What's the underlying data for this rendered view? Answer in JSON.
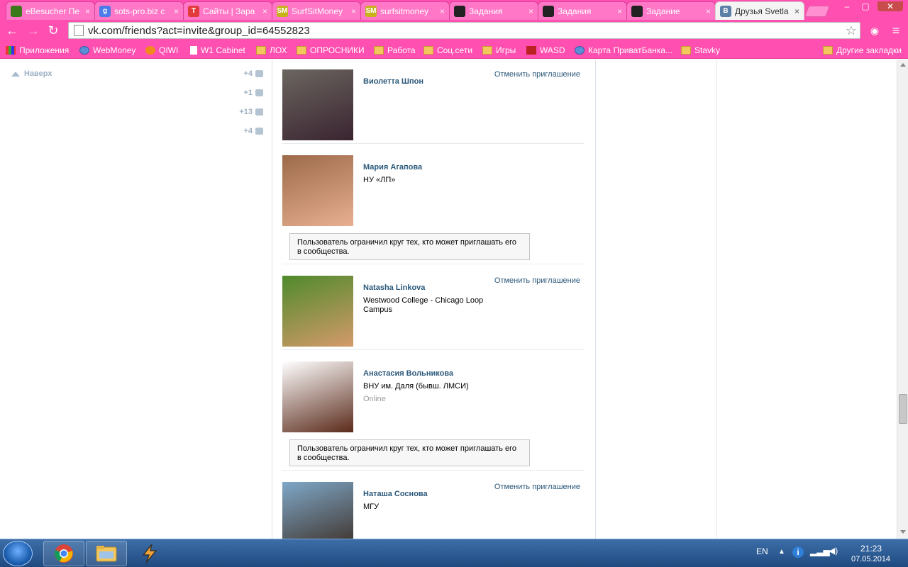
{
  "browser": {
    "tabs": [
      {
        "title": "eBesucher Пе",
        "color": "#3a7a1a",
        "glyph": ""
      },
      {
        "title": "sots-pro.biz с",
        "color": "#4b7be8",
        "glyph": "g"
      },
      {
        "title": "Сайты | Зара",
        "color": "#e23b3b",
        "glyph": "T"
      },
      {
        "title": "SurfSitMoney",
        "color": "#c7b21a",
        "glyph": "SM"
      },
      {
        "title": "surfsitmoney",
        "color": "#c7b21a",
        "glyph": "SM"
      },
      {
        "title": "Задания",
        "color": "#222222",
        "glyph": ""
      },
      {
        "title": "Задания",
        "color": "#222222",
        "glyph": ""
      },
      {
        "title": "Задание",
        "color": "#222222",
        "glyph": ""
      },
      {
        "title": "Друзья Svetla",
        "color": "#5b7fa6",
        "glyph": "B"
      }
    ],
    "close_glyph": "×",
    "url": "vk.com/friends?act=invite&group_id=64552823",
    "bookmarks": [
      {
        "label": "Приложения",
        "icon": "apps-icon"
      },
      {
        "label": "WebMoney",
        "icon": "globe-icon"
      },
      {
        "label": "QIWI",
        "icon": "qiwi-icon"
      },
      {
        "label": "W1 Cabinet",
        "icon": "page-icon"
      },
      {
        "label": "ЛОХ",
        "icon": "folder-icon"
      },
      {
        "label": "ОПРОСНИКИ",
        "icon": "folder-icon"
      },
      {
        "label": "Работа",
        "icon": "folder-icon"
      },
      {
        "label": "Соц.сети",
        "icon": "folder-icon"
      },
      {
        "label": "Игры",
        "icon": "folder-icon"
      },
      {
        "label": "WASD",
        "icon": "wasd-icon"
      },
      {
        "label": "Карта ПриватБанка...",
        "icon": "globe-icon"
      },
      {
        "label": "Stavky",
        "icon": "folder-icon"
      }
    ],
    "other_bookmarks": "Другие закладки"
  },
  "sidebar": {
    "up_label": "Наверх",
    "counters": [
      {
        "value": "+4",
        "icon": "friends-icon"
      },
      {
        "value": "+1",
        "icon": "mail-icon"
      },
      {
        "value": "+13",
        "icon": "comments-icon"
      },
      {
        "value": "+4",
        "icon": "settings-icon"
      }
    ]
  },
  "friends": [
    {
      "name": "Виолетта Шпон",
      "subtitle": "",
      "online": "",
      "action": "Отменить приглашение",
      "notice": "",
      "photo_colors": [
        "#6b6660",
        "#3a2430"
      ]
    },
    {
      "name": "Мария Агапова",
      "subtitle": "НУ «ЛП»",
      "online": "",
      "action": "",
      "notice": "Пользователь ограничил круг тех, кто может приглашать его в сообщества.",
      "photo_colors": [
        "#9c6a4a",
        "#e8b090"
      ]
    },
    {
      "name": "Natasha Linkova",
      "subtitle": "Westwood College - Chicago Loop Campus",
      "online": "",
      "action": "Отменить приглашение",
      "notice": "",
      "photo_colors": [
        "#4f8a2c",
        "#d49a6a"
      ]
    },
    {
      "name": "Анастасия Вольникова",
      "subtitle": "ВНУ им. Даля (бывш. ЛМСИ)",
      "online": "Online",
      "action": "",
      "notice": "Пользователь ограничил круг тех, кто может приглашать его в сообщества.",
      "photo_colors": [
        "#ffffff",
        "#5a2a1a"
      ]
    },
    {
      "name": "Наташа Соснова",
      "subtitle": "МГУ",
      "online": "",
      "action": "Отменить приглашение",
      "notice": "",
      "photo_colors": [
        "#7fa8c8",
        "#3a2a20"
      ]
    }
  ],
  "taskbar": {
    "lang": "EN",
    "time": "21:23",
    "date": "07.05.2014"
  }
}
